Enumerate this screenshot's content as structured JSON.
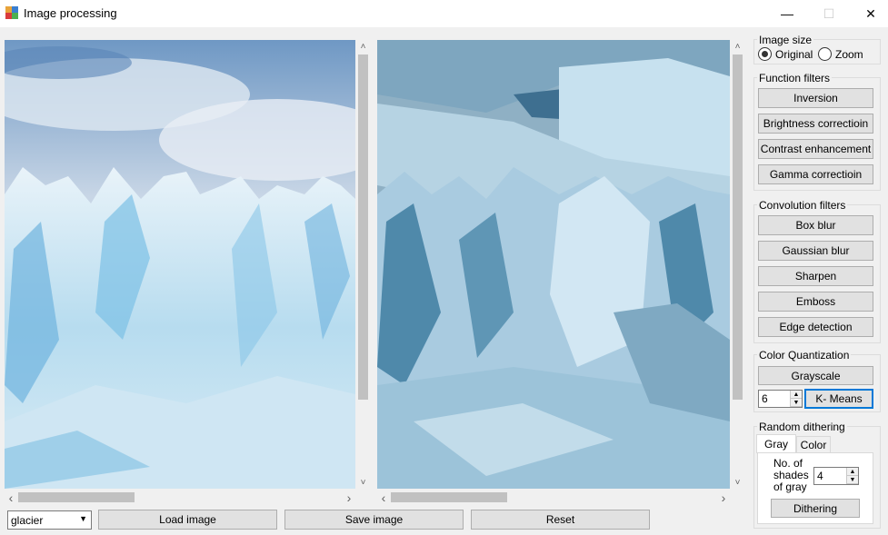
{
  "window": {
    "title": "Image processing",
    "minimize": "—",
    "maximize": "☐",
    "close": "✕"
  },
  "scroll": {
    "up": "˄",
    "down": "˅",
    "left": "‹",
    "right": "›"
  },
  "bottom_bar": {
    "image_select": "glacier",
    "load_button": "Load image",
    "save_button": "Save image",
    "reset_button": "Reset"
  },
  "image_size": {
    "label": "Image size",
    "options": [
      {
        "label": "Original",
        "selected": true
      },
      {
        "label": "Zoom",
        "selected": false
      }
    ]
  },
  "function_filters": {
    "label": "Function filters",
    "buttons": [
      "Inversion",
      "Brightness correctioin",
      "Contrast enhancement",
      "Gamma correctioin"
    ]
  },
  "convolution_filters": {
    "label": "Convolution filters",
    "buttons": [
      "Box blur",
      "Gaussian blur",
      "Sharpen",
      "Emboss",
      "Edge detection"
    ]
  },
  "color_quantization": {
    "label": "Color Quantization",
    "grayscale_button": "Grayscale",
    "k_value": "6",
    "kmeans_button": "K- Means"
  },
  "random_dithering": {
    "label": "Random dithering",
    "tabs": [
      "Gray",
      "Color"
    ],
    "active_tab": "Gray",
    "shades_label_1": "No. of",
    "shades_label_2": "shades",
    "shades_label_3": "of gray",
    "shades_value": "4",
    "dither_button": "Dithering"
  },
  "colors": {
    "accent": "#0078d7",
    "glacier_ice": "#9fd0ec",
    "sky": "#7aa2c8"
  }
}
